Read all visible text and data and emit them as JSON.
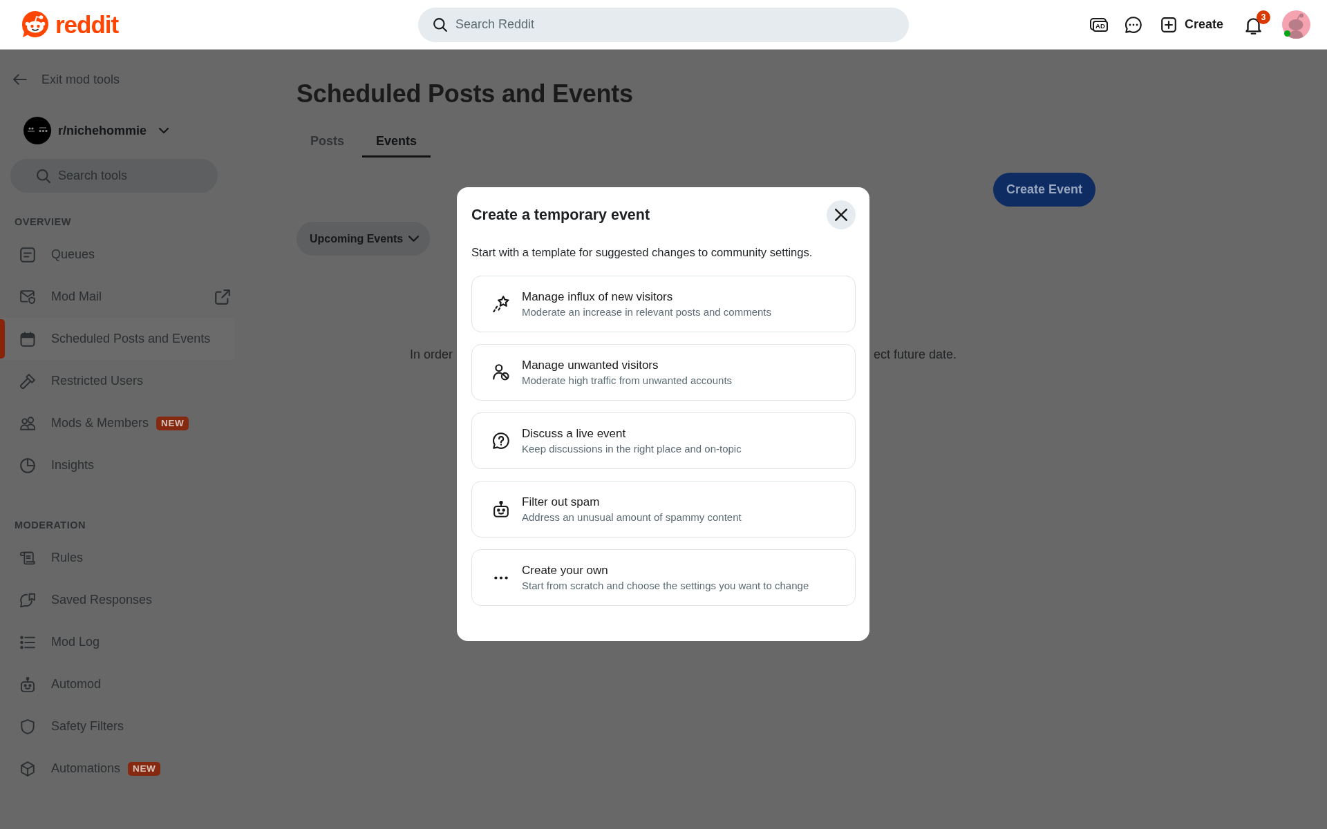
{
  "header": {
    "logo_text": "reddit",
    "search": {
      "placeholder": "Search Reddit"
    },
    "advertise_label": "AD",
    "create_label": "Create",
    "notification_count": "3",
    "user": {
      "online": true
    }
  },
  "sidebar": {
    "exit_label": "Exit mod tools",
    "community": {
      "name": "r/nichehommie"
    },
    "search": {
      "placeholder": "Search tools"
    },
    "sections": [
      {
        "title": "OVERVIEW",
        "items": [
          {
            "label": "Queues",
            "selected": false,
            "external": false
          },
          {
            "label": "Mod Mail",
            "selected": false,
            "external": true
          },
          {
            "label": "Scheduled Posts and Events",
            "selected": true,
            "external": false
          },
          {
            "label": "Restricted Users",
            "selected": false,
            "external": false
          },
          {
            "label": "Mods & Members",
            "selected": false,
            "external": false,
            "badge": "NEW"
          },
          {
            "label": "Insights",
            "selected": false,
            "external": false
          }
        ]
      },
      {
        "title": "MODERATION",
        "items": [
          {
            "label": "Rules",
            "selected": false,
            "external": false
          },
          {
            "label": "Saved Responses",
            "selected": false,
            "external": false
          },
          {
            "label": "Mod Log",
            "selected": false,
            "external": false
          },
          {
            "label": "Automod",
            "selected": false,
            "external": false
          },
          {
            "label": "Safety Filters",
            "selected": false,
            "external": false
          },
          {
            "label": "Automations",
            "selected": false,
            "external": false,
            "badge": "NEW"
          }
        ]
      }
    ]
  },
  "main": {
    "title": "Scheduled Posts and Events",
    "tabs": [
      {
        "label": "Posts",
        "selected": false
      },
      {
        "label": "Events",
        "selected": true
      }
    ],
    "create_button": "Create Event",
    "filter_dropdown": "Upcoming Events",
    "empty_message_visible_parts": [
      "In order",
      "ect future date."
    ]
  },
  "modal": {
    "title": "Create a temporary event",
    "description": "Start with a template for suggested changes to community settings.",
    "options": [
      {
        "title": "Manage influx of new visitors",
        "subtitle": "Moderate an increase in relevant posts and comments"
      },
      {
        "title": "Manage unwanted visitors",
        "subtitle": "Moderate high traffic from unwanted accounts"
      },
      {
        "title": "Discuss a live event",
        "subtitle": "Keep discussions in the right place and on-topic"
      },
      {
        "title": "Filter out spam",
        "subtitle": "Address an unusual amount of spammy content"
      },
      {
        "title": "Create your own",
        "subtitle": "Start from scratch and choose the settings you want to change"
      }
    ]
  }
}
